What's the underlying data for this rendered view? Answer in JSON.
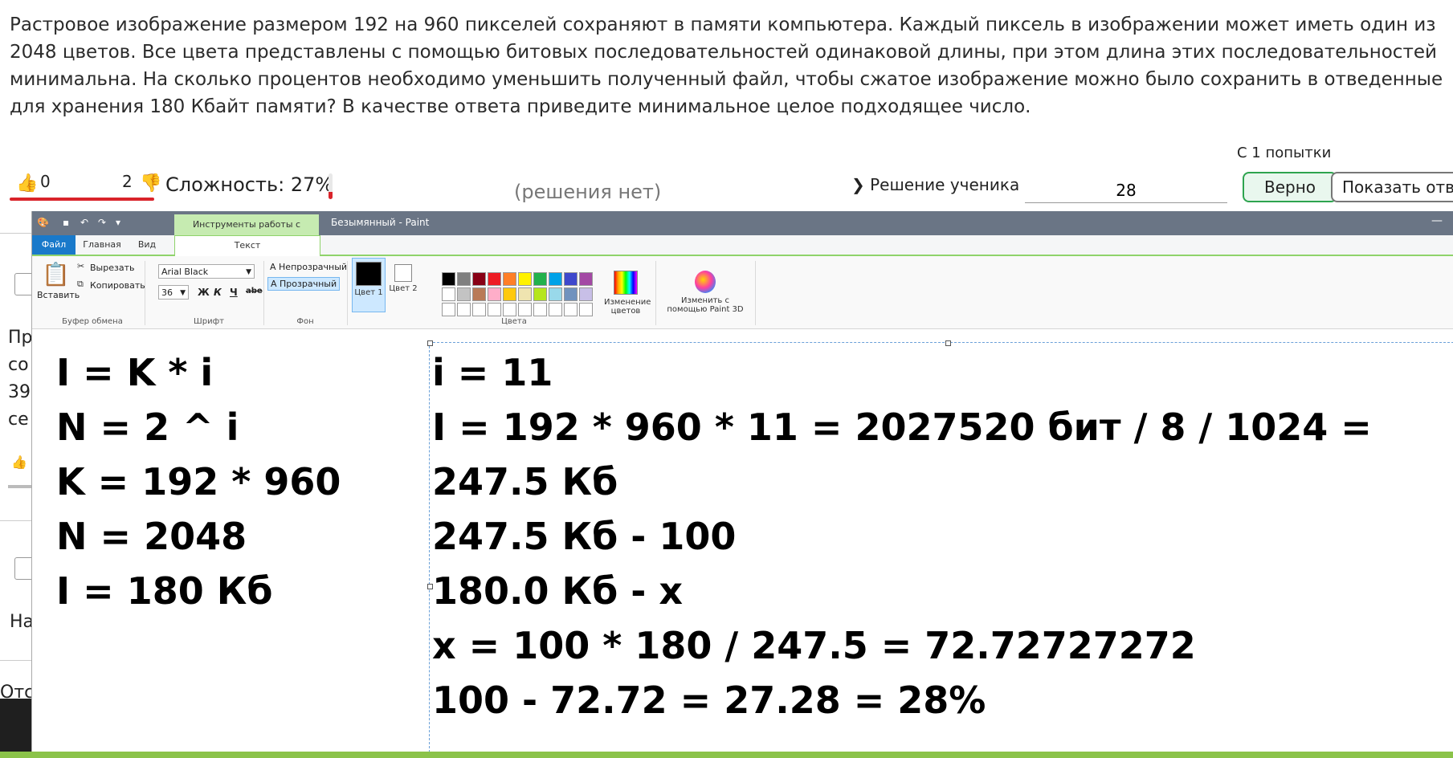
{
  "problem_text": "Растровое изображение размером 192 на 960 пикселей сохраняют в памяти компьютера. Каждый пиксель в изображении может иметь один из 2048 цветов. Все цвета представлены с помощью битовых последовательностей одинаковой длины, при этом длина этих последовательностей минимальна. На сколько процентов необходимо уменьшить полученный файл, чтобы сжатое изображение можно было сохранить в отведенные для хранения 180 Кбайт памяти? В качестве ответа приведите минимальное целое подходящее число.",
  "rating": {
    "likes": "0",
    "dislikes": "2"
  },
  "difficulty": {
    "label": "Сложность: 27%",
    "level": 0.27
  },
  "no_solutions": "(решения нет)",
  "attempts": "С 1 попытки",
  "student_solution": "Решение ученика",
  "answer_value": "28",
  "buttons": {
    "correct": "Верно",
    "show_answer": "Показать ответ"
  },
  "background_fragments": [
    "Пр",
    "со",
    "39",
    "се",
    "На",
    "Отс"
  ],
  "paint": {
    "context_tab": "Инструменты работы с текстом",
    "window_title": "Безымянный - Paint",
    "tabs": {
      "file": "Файл",
      "home": "Главная",
      "view": "Вид",
      "text": "Текст"
    },
    "clipboard": {
      "paste": "Вставить",
      "cut": "Вырезать",
      "copy": "Копировать",
      "group": "Буфер обмена"
    },
    "font": {
      "name": "Arial Black",
      "size": "36",
      "bold": "Ж",
      "italic": "К",
      "underline": "Ч",
      "strike": "abe",
      "group": "Шрифт"
    },
    "background": {
      "opaque": "Непрозрачный",
      "transparent": "Прозрачный",
      "group": "Фон"
    },
    "colors": {
      "color1": "Цвет 1",
      "color2": "Цвет 2",
      "edit": "Изменение цветов",
      "paint3d": "Изменить с помощью Paint 3D",
      "group": "Цвета"
    },
    "palette": [
      "#000000",
      "#7f7f7f",
      "#880015",
      "#ed1c24",
      "#ff7f27",
      "#fff200",
      "#22b14c",
      "#00a2e8",
      "#3f48cc",
      "#a349a4",
      "#ffffff",
      "#c3c3c3",
      "#b97a57",
      "#ffaec9",
      "#ffc90e",
      "#efe4b0",
      "#b5e61d",
      "#99d9ea",
      "#7092be",
      "#c8bfe7",
      "#ffffff",
      "#ffffff",
      "#ffffff",
      "#ffffff",
      "#ffffff",
      "#ffffff",
      "#ffffff",
      "#ffffff",
      "#ffffff",
      "#ffffff"
    ]
  },
  "canvas_left": [
    "I = K * i",
    "N = 2 ^ i",
    "K = 192 * 960",
    "N = 2048",
    "I = 180 Кб"
  ],
  "canvas_right": [
    "i = 11",
    "I = 192 * 960 * 11 = 2027520 бит / 8 / 1024 =",
    "247.5 Кб",
    "247.5 Кб - 100",
    "180.0 Кб - x",
    "x = 100 * 180 / 247.5 = 72.72727272",
    "100 - 72.72 = 27.28 = 28%"
  ]
}
